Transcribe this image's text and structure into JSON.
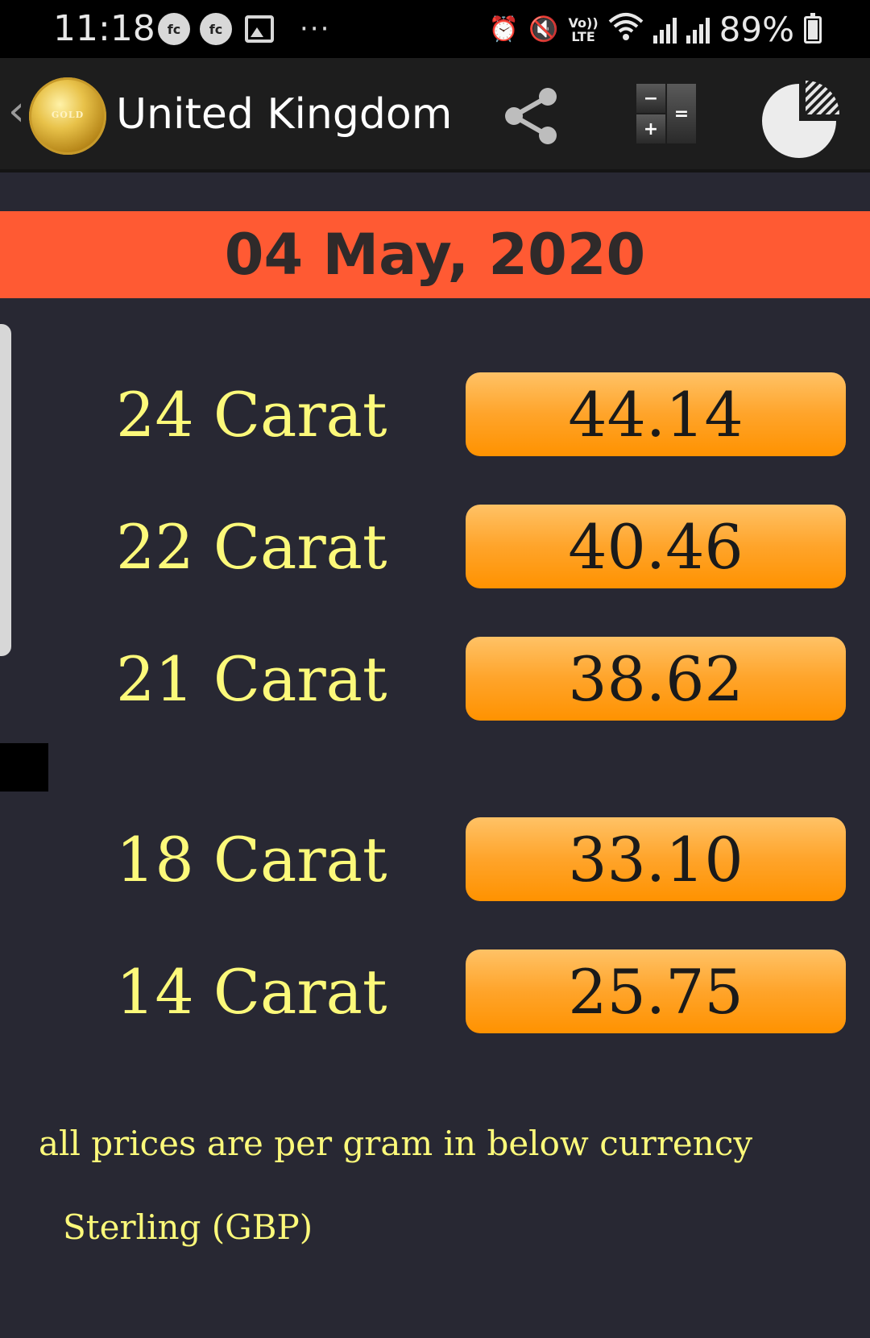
{
  "status_bar": {
    "time": "11:18",
    "notif_1": "fc",
    "notif_2": "fc",
    "more": "···",
    "lte_top": "Vo))",
    "lte_bottom": "LTE",
    "battery": "89%"
  },
  "app_bar": {
    "back": "‹",
    "logo_text": "GOLD",
    "title": "United Kingdom",
    "calc_minus": "−",
    "calc_plus": "+",
    "calc_equals": "="
  },
  "date": "04 May, 2020",
  "prices": [
    {
      "label": "24 Carat",
      "value": "44.14"
    },
    {
      "label": "22 Carat",
      "value": "40.46"
    },
    {
      "label": "21 Carat",
      "value": "38.62"
    },
    {
      "label": "18 Carat",
      "value": "33.10"
    },
    {
      "label": "14 Carat",
      "value": "25.75"
    }
  ],
  "note": "all prices are per gram in below currency",
  "currency": "Sterling (GBP)",
  "colors": {
    "accent": "#ff5a33",
    "label_yellow": "#fcf97a",
    "pill_orange": "#ffa42a",
    "background": "#282833"
  }
}
